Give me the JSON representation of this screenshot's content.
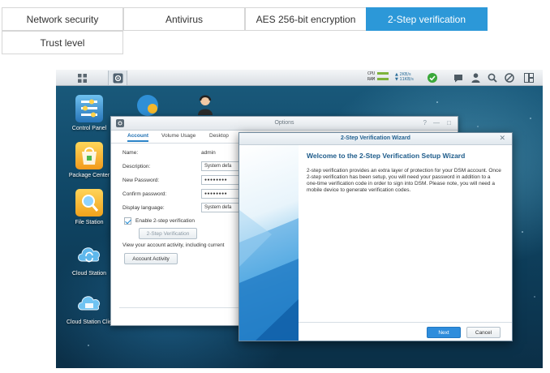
{
  "top_tabs": [
    {
      "label": "Network security"
    },
    {
      "label": "Antivirus"
    },
    {
      "label": "AES 256-bit encryption"
    },
    {
      "label": "2-Step verification"
    },
    {
      "label": "Trust level"
    }
  ],
  "active_tab_index": 3,
  "colors": {
    "accent": "#2c98d8",
    "wizard_title": "#1d5b8a",
    "next_button": "#2e8ddc"
  },
  "taskbar": {
    "cpu_label": "CPU",
    "ram_label": "RAM",
    "upload": "2KB/s",
    "download": "11KB/s",
    "icons": [
      "main-menu-icon",
      "app-icon",
      "resource-monitor-icon",
      "notification-icon",
      "user-icon",
      "search-icon",
      "widgets-icon",
      "windows-icon"
    ]
  },
  "desktop": {
    "icons": [
      {
        "label": "Control Panel",
        "icon": "control-panel-icon"
      },
      {
        "label": "Package Center",
        "icon": "package-center-icon"
      },
      {
        "label": "File Station",
        "icon": "file-station-icon"
      },
      {
        "label": "Cloud Station",
        "icon": "cloud-station-icon"
      },
      {
        "label": "Cloud Station Clie",
        "icon": "cloud-station-client-icon"
      }
    ]
  },
  "options_window": {
    "title": "Options",
    "tabs": [
      "Account",
      "Volume Usage",
      "Desktop"
    ],
    "fields": {
      "name_label": "Name:",
      "name_value": "admin",
      "description_label": "Description:",
      "description_value": "System defa",
      "new_password_label": "New Password:",
      "new_password_value": "●●●●●●●●",
      "confirm_password_label": "Confirm password:",
      "confirm_password_value": "●●●●●●●●",
      "display_language_label": "Display language:",
      "display_language_value": "System defa"
    },
    "enable_2step_label": "Enable 2-step verification",
    "enable_2step_checked": true,
    "two_step_button": "2-Step Verification",
    "activity_text": "View your account activity, including current",
    "account_activity_button": "Account Activity"
  },
  "wizard": {
    "title": "2-Step Verification Wizard",
    "heading": "Welcome to the 2-Step Verification Setup Wizard",
    "body": "2-step verification provides an extra layer of protection for your DSM account. Once 2-step verification has been setup, you will need your password in addition to a one-time verification code in order to sign into DSM. Please note, you will need a mobile device to generate verification codes.",
    "next_button": "Next",
    "cancel_button": "Cancel"
  }
}
